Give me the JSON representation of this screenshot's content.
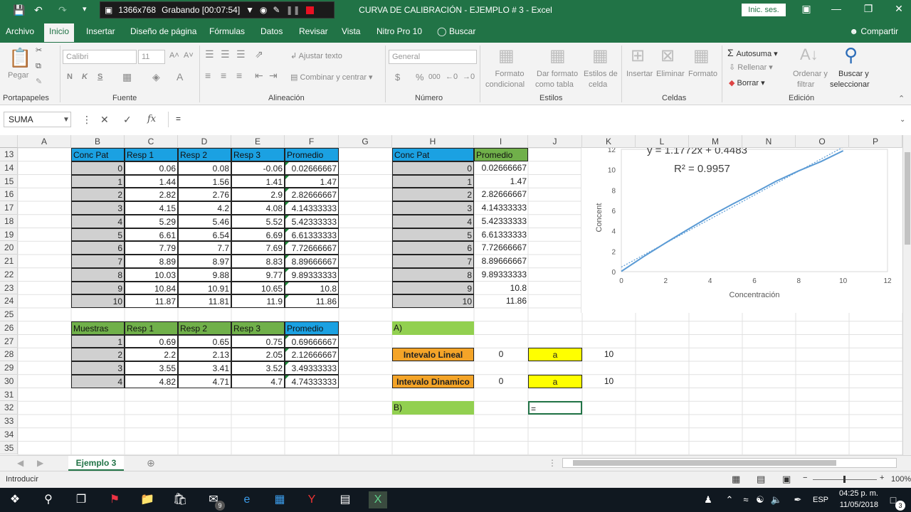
{
  "window": {
    "title": "CURVA DE CALIBRACIÓN - EJEMPLO # 3  -  Excel",
    "sign_in": "Inic. ses.",
    "recorder": {
      "resolution": "1366x768",
      "status": "Grabando [00:07:54]"
    }
  },
  "ribbon": {
    "tabs": [
      "Archivo",
      "Inicio",
      "Insertar",
      "Diseño de página",
      "Fórmulas",
      "Datos",
      "Revisar",
      "Vista",
      "Nitro Pro 10",
      "Buscar"
    ],
    "active_tab": "Inicio",
    "share": "Compartir",
    "clipboard": {
      "paste": "Pegar",
      "label": "Portapapeles"
    },
    "font": {
      "name": "Calibri",
      "size": "11",
      "label": "Fuente",
      "bold": "N",
      "italic": "K",
      "underline": "S"
    },
    "alignment": {
      "wrap": "Ajustar texto",
      "merge": "Combinar y centrar",
      "label": "Alineación"
    },
    "number": {
      "format": "General",
      "label": "Número",
      "currency": "$",
      "percent": "%",
      "thousands": "000"
    },
    "styles": {
      "conditional_1": "Formato",
      "conditional_2": "condicional",
      "table_1": "Dar formato",
      "table_2": "como tabla",
      "cell_styles_1": "Estilos de",
      "cell_styles_2": "celda",
      "label": "Estilos"
    },
    "cells": {
      "insert": "Insertar",
      "delete": "Eliminar",
      "format": "Formato",
      "label": "Celdas"
    },
    "editing": {
      "autosum": "Autosuma",
      "fill": "Rellenar",
      "clear": "Borrar",
      "sort_1": "Ordenar y",
      "sort_2": "filtrar",
      "find_1": "Buscar y",
      "find_2": "seleccionar",
      "label": "Edición"
    }
  },
  "formula_bar": {
    "name_box": "SUMA",
    "fx": "fx",
    "value": "="
  },
  "columns": [
    "A",
    "B",
    "C",
    "D",
    "E",
    "F",
    "G",
    "H",
    "I",
    "J",
    "K",
    "L",
    "M",
    "N",
    "O",
    "P"
  ],
  "rows": [
    "13",
    "14",
    "15",
    "16",
    "17",
    "18",
    "19",
    "20",
    "21",
    "22",
    "23",
    "24",
    "25",
    "26",
    "27",
    "28",
    "29",
    "30",
    "31",
    "32",
    "33",
    "34",
    "35"
  ],
  "table1": {
    "headers": [
      "Conc Pat",
      "Resp 1",
      "Resp 2",
      "Resp 3",
      "Promedio"
    ],
    "rows": [
      [
        "0",
        "0.06",
        "0.08",
        "-0.06",
        "0.02666667"
      ],
      [
        "1",
        "1.44",
        "1.56",
        "1.41",
        "1.47"
      ],
      [
        "2",
        "2.82",
        "2.76",
        "2.9",
        "2.82666667"
      ],
      [
        "3",
        "4.15",
        "4.2",
        "4.08",
        "4.14333333"
      ],
      [
        "4",
        "5.29",
        "5.46",
        "5.52",
        "5.42333333"
      ],
      [
        "5",
        "6.61",
        "6.54",
        "6.69",
        "6.61333333"
      ],
      [
        "6",
        "7.79",
        "7.7",
        "7.69",
        "7.72666667"
      ],
      [
        "7",
        "8.89",
        "8.97",
        "8.83",
        "8.89666667"
      ],
      [
        "8",
        "10.03",
        "9.88",
        "9.77",
        "9.89333333"
      ],
      [
        "9",
        "10.84",
        "10.91",
        "10.65",
        "10.8"
      ],
      [
        "10",
        "11.87",
        "11.81",
        "11.9",
        "11.86"
      ]
    ]
  },
  "table2": {
    "headers": [
      "Muestras",
      "Resp 1",
      "Resp 2",
      "Resp 3",
      "Promedio"
    ],
    "rows": [
      [
        "1",
        "0.69",
        "0.65",
        "0.75",
        "0.69666667"
      ],
      [
        "2",
        "2.2",
        "2.13",
        "2.05",
        "2.12666667"
      ],
      [
        "3",
        "3.55",
        "3.41",
        "3.52",
        "3.49333333"
      ],
      [
        "4",
        "4.82",
        "4.71",
        "4.7",
        "4.74333333"
      ]
    ]
  },
  "table3": {
    "headers": [
      "Conc Pat",
      "Promedio"
    ],
    "rows": [
      [
        "0",
        "0.02666667"
      ],
      [
        "1",
        "1.47"
      ],
      [
        "2",
        "2.82666667"
      ],
      [
        "3",
        "4.14333333"
      ],
      [
        "4",
        "5.42333333"
      ],
      [
        "5",
        "6.61333333"
      ],
      [
        "6",
        "7.72666667"
      ],
      [
        "7",
        "8.89666667"
      ],
      [
        "8",
        "9.89333333"
      ],
      [
        "9",
        "10.8"
      ],
      [
        "10",
        "11.86"
      ]
    ]
  },
  "answers": {
    "a_label": "A)",
    "b_label": "B)",
    "lineal": {
      "label": "Intevalo Lineal",
      "from": "0",
      "sep": "a",
      "to": "10"
    },
    "dinamico": {
      "label": "Intevalo Dinamico",
      "from": "0",
      "sep": "a",
      "to": "10"
    },
    "editing_cell": "="
  },
  "chart_data": {
    "type": "line",
    "equation": "y = 1.1772x + 0.4483",
    "r2": "R² = 0.9957",
    "xlabel": "Concentración",
    "ylabel": "Concent",
    "xlim": [
      0,
      12
    ],
    "ylim": [
      0,
      12
    ],
    "xticks": [
      "0",
      "2",
      "4",
      "6",
      "8",
      "10",
      "12"
    ],
    "yticks": [
      "0",
      "2",
      "4",
      "6",
      "8",
      "10",
      "12"
    ],
    "x": [
      0,
      1,
      2,
      3,
      4,
      5,
      6,
      7,
      8,
      9,
      10
    ],
    "series": [
      {
        "values": [
          0.02666667,
          1.47,
          2.82666667,
          4.14333333,
          5.42333333,
          6.61333333,
          7.72666667,
          8.89666667,
          9.89333333,
          10.8,
          11.86
        ]
      }
    ],
    "trendline": {
      "slope": 1.1772,
      "intercept": 0.4483
    },
    "series_color": "#5b9bd5"
  },
  "sheet": {
    "tab": "Ejemplo 3",
    "status": "Introducir",
    "zoom": "100%"
  },
  "taskbar": {
    "time": "04:25 p. m.",
    "date": "11/05/2018",
    "lang": "ESP",
    "mail_badge": "9",
    "notif_badge": "3"
  }
}
